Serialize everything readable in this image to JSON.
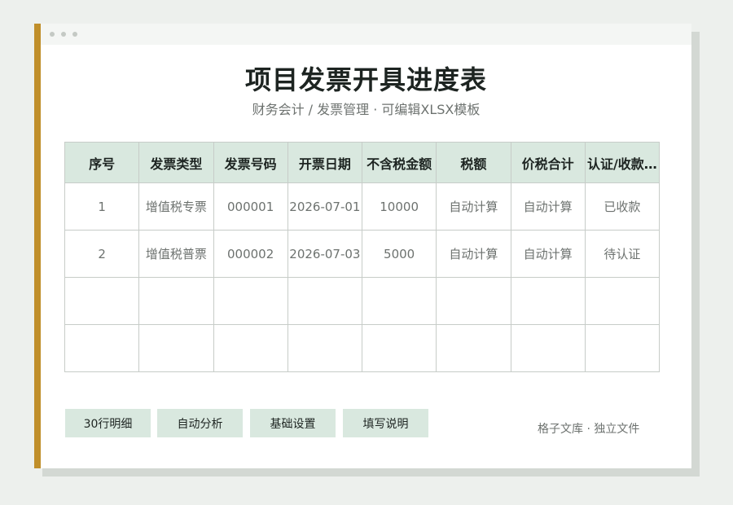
{
  "title": "项目发票开具进度表",
  "subtitle": "财务会计 / 发票管理 · 可编辑XLSX模板",
  "table": {
    "headers": [
      "序号",
      "发票类型",
      "发票号码",
      "开票日期",
      "不含税金额",
      "税额",
      "价税合计",
      "认证/收款…"
    ],
    "rows": [
      [
        "1",
        "增值税专票",
        "000001",
        "2026-07-01",
        "10000",
        "自动计算",
        "自动计算",
        "已收款"
      ],
      [
        "2",
        "增值税普票",
        "000002",
        "2026-07-03",
        "5000",
        "自动计算",
        "自动计算",
        "待认证"
      ],
      [
        "",
        "",
        "",
        "",
        "",
        "",
        "",
        ""
      ],
      [
        "",
        "",
        "",
        "",
        "",
        "",
        "",
        ""
      ]
    ]
  },
  "buttons": {
    "detail": "30行明细",
    "analysis": "自动分析",
    "settings": "基础设置",
    "instructions": "填写说明"
  },
  "footer": "格子文库 · 独立文件",
  "colors": {
    "accent": "#c08f2a",
    "header_bg": "#d9e8df",
    "page_bg": "#edf0ed"
  }
}
